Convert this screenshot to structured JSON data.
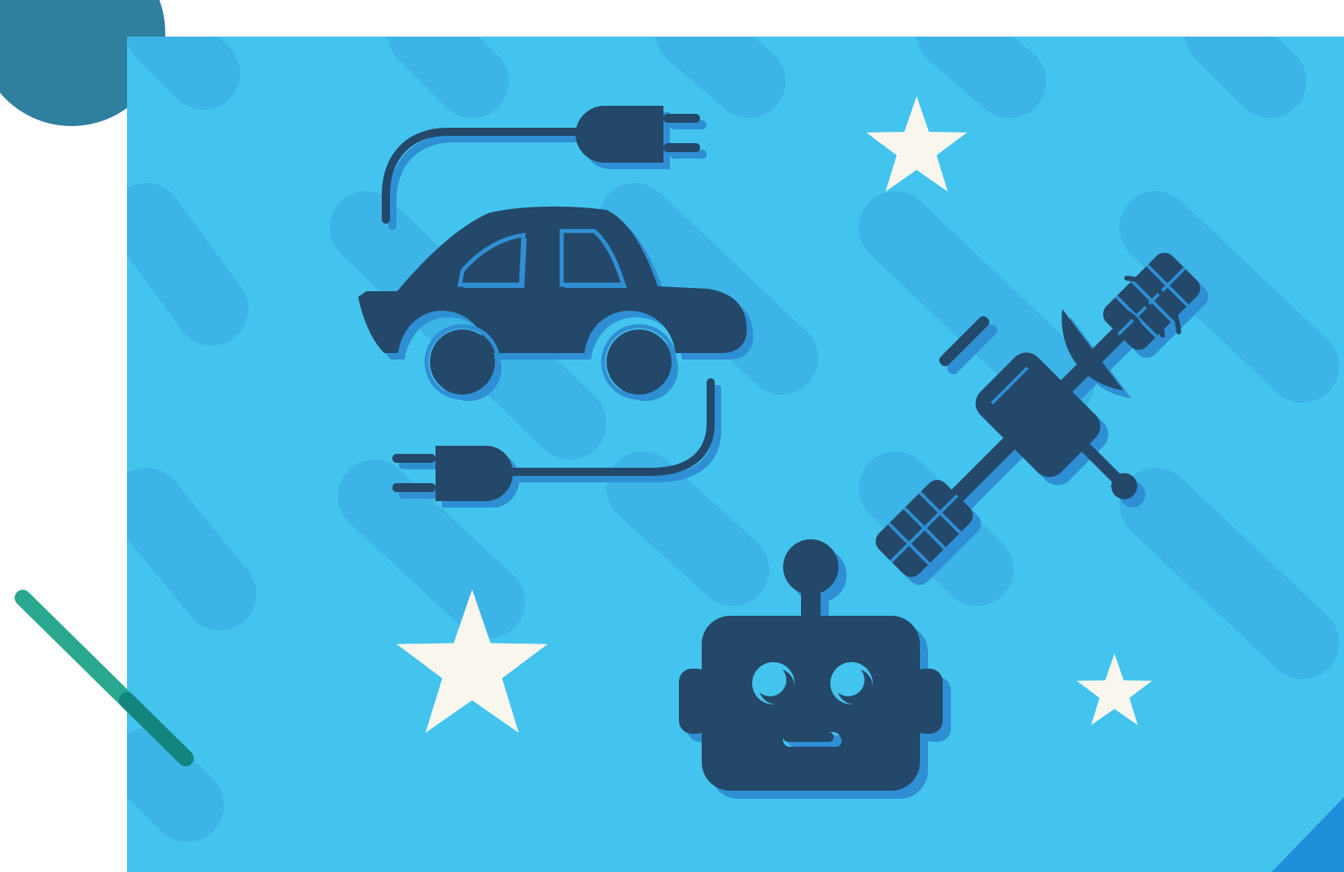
{
  "colors": {
    "page_background": "#ffffff",
    "panel_blue": "#43c4ee",
    "stripe_blue": "#3bb2e6",
    "icon_navy": "#234869",
    "icon_shadow": "#2f8fd4",
    "star_cream": "#f9f6ee",
    "corner_circle": "#2f7f9f",
    "green_bar": "#2aa88f",
    "corner_triangle": "#1f8fdb"
  },
  "illustration": {
    "icons": [
      "electric-car-icon",
      "plug-icon",
      "satellite-icon",
      "robot-icon",
      "star-icon"
    ],
    "star_count": 3,
    "decorations": [
      "teal-circle",
      "green-diagonal-bar",
      "blue-corner-triangle",
      "diagonal-stripes"
    ]
  }
}
